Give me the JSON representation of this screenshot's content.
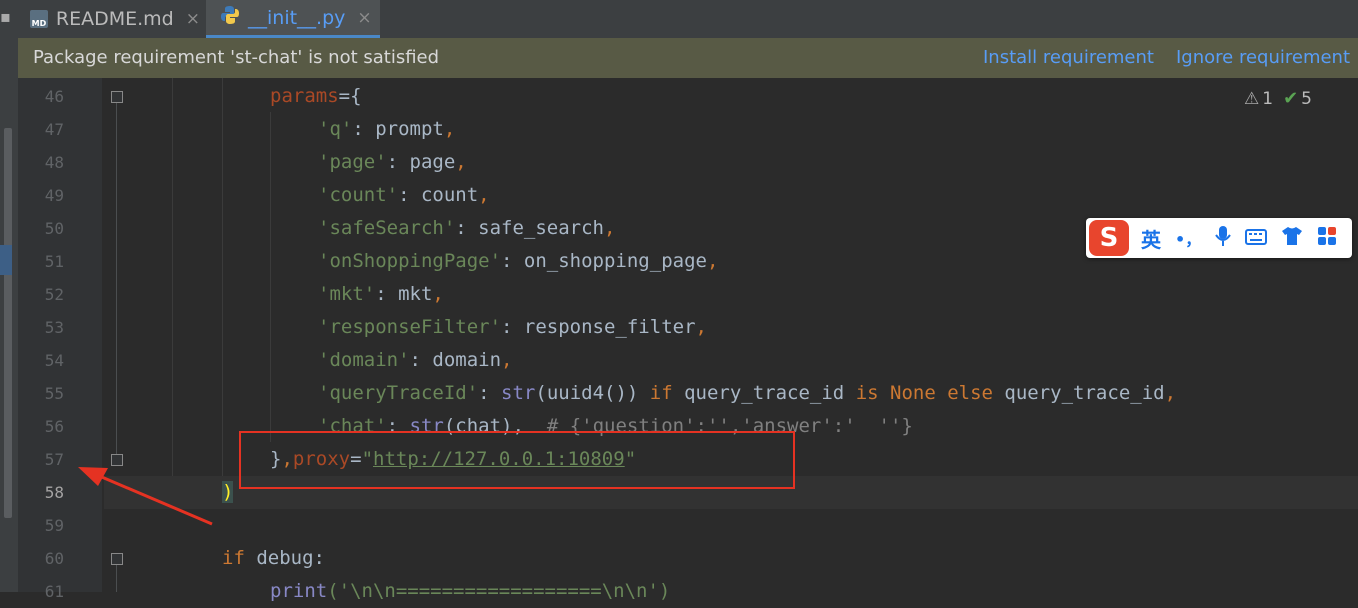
{
  "tabs": [
    {
      "label": "README.md",
      "icon": "markdown-file-icon",
      "active": false
    },
    {
      "label": "__init__.py",
      "icon": "python-file-icon",
      "active": true
    }
  ],
  "tab_close_glyph": "×",
  "banner": {
    "message": "Package requirement 'st-chat' is not satisfied",
    "install_link": "Install requirement",
    "ignore_link": "Ignore requirement"
  },
  "inspections": {
    "warnings": "1",
    "ok": "5"
  },
  "line_numbers": [
    "46",
    "47",
    "48",
    "49",
    "50",
    "51",
    "52",
    "53",
    "54",
    "55",
    "56",
    "57",
    "58",
    "59",
    "60",
    "61"
  ],
  "code": {
    "l46": {
      "name": "params",
      "op": "={"
    },
    "l47": {
      "key": "'q'",
      "sep": ": ",
      "val": "prompt",
      "comma": ","
    },
    "l48": {
      "key": "'page'",
      "sep": ": ",
      "val": "page",
      "comma": ","
    },
    "l49": {
      "key": "'count'",
      "sep": ": ",
      "val": "count",
      "comma": ","
    },
    "l50": {
      "key": "'safeSearch'",
      "sep": ": ",
      "val": "safe_search",
      "comma": ","
    },
    "l51": {
      "key": "'onShoppingPage'",
      "sep": ": ",
      "val": "on_shopping_page",
      "comma": ","
    },
    "l52": {
      "key": "'mkt'",
      "sep": ": ",
      "val": "mkt",
      "comma": ","
    },
    "l53": {
      "key": "'responseFilter'",
      "sep": ": ",
      "val": "response_filter",
      "comma": ","
    },
    "l54": {
      "key": "'domain'",
      "sep": ": ",
      "val": "domain",
      "comma": ","
    },
    "l55": {
      "key": "'queryTraceId'",
      "sep": ": ",
      "fn": "str",
      "a": "(uuid4()) ",
      "if": "if",
      "b": " query_trace_id ",
      "is": "is",
      "none": " None ",
      "else": "else",
      "c": " query_trace_id",
      "comma": ","
    },
    "l56": {
      "key": "'chat'",
      "sep": ": ",
      "fn": "str",
      "a": "(chat),  ",
      "comment": "# {'question':'','answer':'  ''}"
    },
    "l57": {
      "close": "}",
      "comma": ",",
      "param": "proxy",
      "eq": "=",
      "q1": "\"",
      "url": "http://127.0.0.1:10809",
      "q2": "\""
    },
    "l58": {
      "paren": ")"
    },
    "l60": {
      "if": "if",
      "rest": " debug:"
    },
    "l61": {
      "fn": "print",
      "rest": "('\\n\\n==================\\n\\n')"
    }
  },
  "ime": {
    "logo": "S",
    "mode": "英",
    "punct": "•，"
  }
}
